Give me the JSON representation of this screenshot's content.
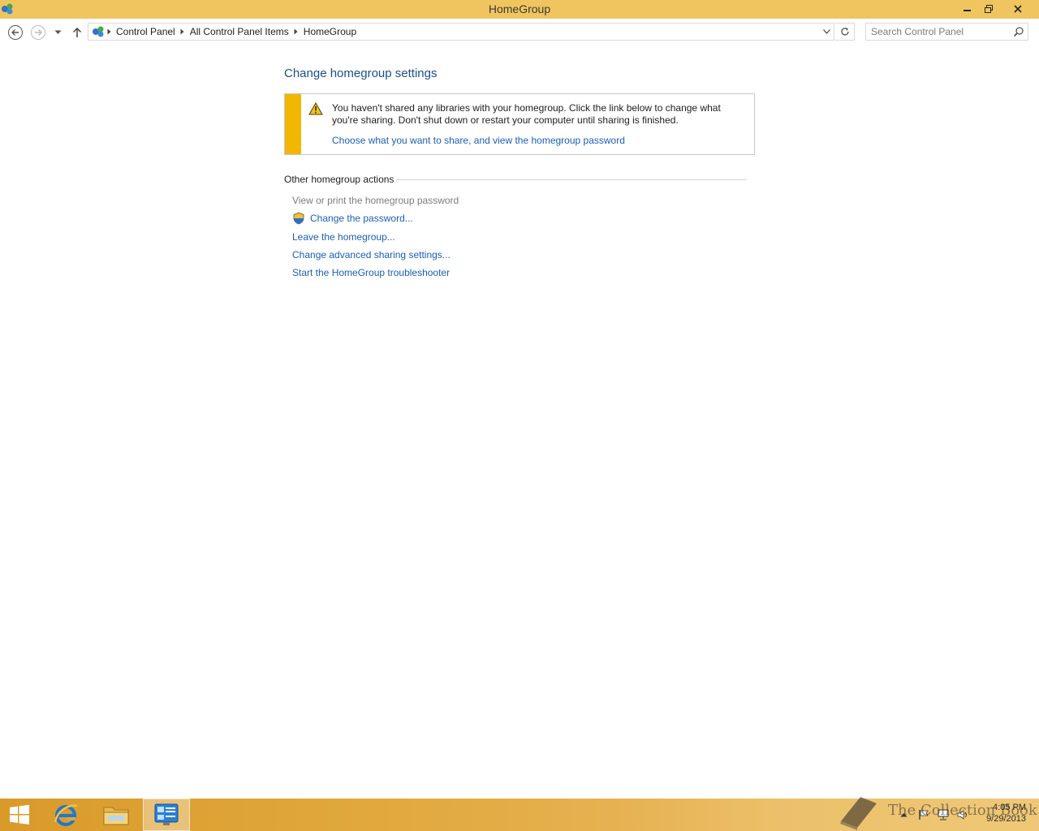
{
  "window": {
    "title": "HomeGroup",
    "icons": {
      "app": "homegroup-icon",
      "minimize": "minimize-icon",
      "restore": "restore-icon",
      "close": "close-icon"
    }
  },
  "nav": {
    "icons": {
      "back": "back-arrow-icon",
      "forward": "forward-arrow-icon",
      "recent": "chevron-down-icon",
      "up": "up-arrow-icon"
    },
    "breadcrumb": [
      "Control Panel",
      "All Control Panel Items",
      "HomeGroup"
    ],
    "search_placeholder": "Search Control Panel"
  },
  "main": {
    "title": "Change homegroup settings",
    "notice": {
      "message": "You haven't shared any libraries with your homegroup. Click the link below to change what you're sharing. Don't shut down or restart your computer until sharing is finished.",
      "link": "Choose what you want to share, and view the homegroup password"
    },
    "section_title": "Other homegroup actions",
    "actions": [
      {
        "label": "View or print the homegroup password",
        "enabled": false
      },
      {
        "label": "Change the password...",
        "enabled": true,
        "icon": "uac-shield-icon"
      },
      {
        "label": "Leave the homegroup...",
        "enabled": true
      },
      {
        "label": "Change advanced sharing settings...",
        "enabled": true
      },
      {
        "label": "Start the HomeGroup troubleshooter",
        "enabled": true
      }
    ]
  },
  "taskbar": {
    "items": [
      "start-button",
      "internet-explorer",
      "file-explorer",
      "control-panel"
    ],
    "clock_time": "4:05 PM",
    "clock_date": "9/29/2013"
  },
  "watermark": "The Collection Book",
  "colors": {
    "titlebar": "#f0c55f",
    "link": "#1a5fb4",
    "title": "#1b4f8c",
    "notice_bar": "#f2b705"
  }
}
